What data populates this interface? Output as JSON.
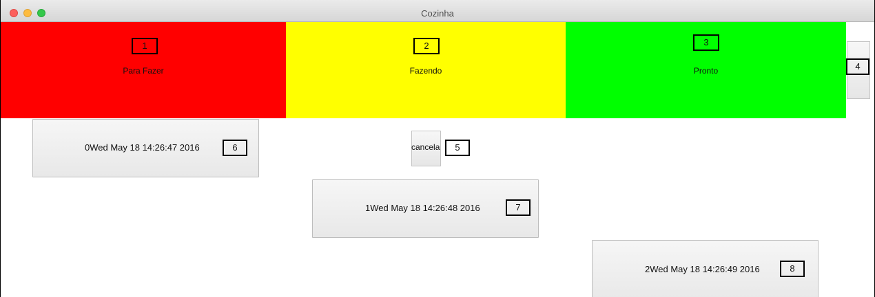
{
  "window": {
    "title": "Cozinha"
  },
  "columns": [
    {
      "label": "Para Fazer",
      "tag": "1",
      "color": "#ff0000"
    },
    {
      "label": "Fazendo",
      "tag": "2",
      "color": "#ffff00"
    },
    {
      "label": "Pronto",
      "tag": "3",
      "color": "#00ff00"
    }
  ],
  "side_button": {
    "tag": "4"
  },
  "cancel_button": {
    "label": "cancela",
    "tag": "5"
  },
  "orders": [
    {
      "text": "0Wed May 18 14:26:47 2016",
      "tag": "6"
    },
    {
      "text": "1Wed May 18 14:26:48 2016",
      "tag": "7"
    },
    {
      "text": "2Wed May 18 14:26:49 2016",
      "tag": "8"
    }
  ]
}
